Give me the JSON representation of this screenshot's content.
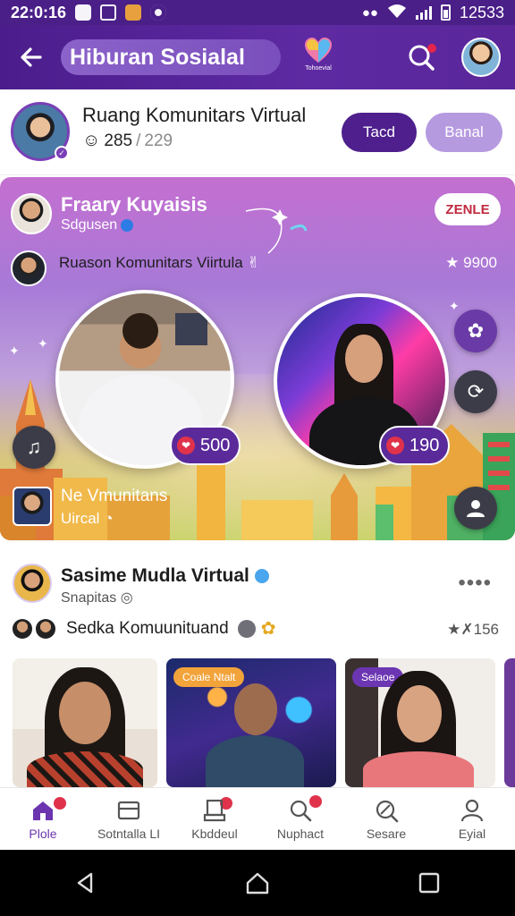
{
  "status_bar": {
    "time": "22:0:16",
    "battery": "12533"
  },
  "app_bar": {
    "title": "Hiburan Sosialal",
    "logo_text": "Tohoevial"
  },
  "room": {
    "title": "Ruang Komunitars Virtual",
    "count_now": "285",
    "separator": "/",
    "count_max": "229",
    "join_label": "Tacd",
    "ban_label": "Banal"
  },
  "live": {
    "host_name": "Fraary Kuyaisis",
    "host_sub": "Sdgusen",
    "zoom_label": "ZENLE",
    "sub_title": "Ruason Komunitars Viirtula",
    "sub_count": "★ 9900",
    "left_badge": "500",
    "right_badge": "190",
    "footer_title": "Ne Vmunitans",
    "footer_sub": "Uircal"
  },
  "feed": {
    "title": "Sasime Mudla Virtual",
    "sub": "Snapitas",
    "row_text": "Sedka Komuunituand",
    "row_count": "★✗156",
    "tag1": "Coale Ntalt",
    "tag2": "Selaoe"
  },
  "nav": {
    "home": "Plole",
    "social": "Sotntalla LI",
    "board": "Kbddeul",
    "notif": "Nuphact",
    "search": "Sesare",
    "profile": "Eyial"
  },
  "colors": {
    "brand": "#4e1f8d",
    "accent": "#7a3fb7",
    "badge": "#e0324b"
  }
}
